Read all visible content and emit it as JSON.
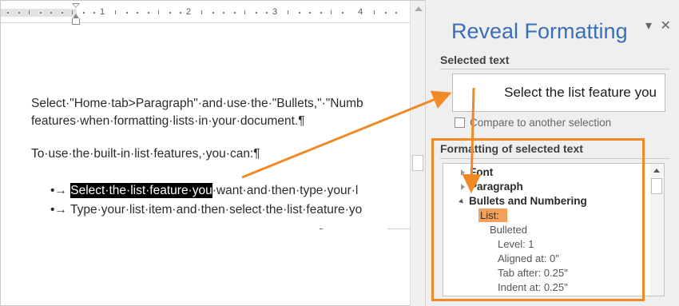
{
  "ruler": {
    "num1": "1",
    "num2": "2",
    "num3": "3",
    "num4": "4"
  },
  "document": {
    "para1_line1": "Select·\"Home·tab>Paragraph\"·and·use·the·\"Bullets,\"·\"Numb",
    "para1_line2": "features·when·formatting·lists·in·your·document.¶",
    "para2": "To·use·the·built-in·list·features,·you·can:¶",
    "bullet1_marker": "•→",
    "bullet1_selected": "Select·the·list·feature·you",
    "bullet1_rest": "·want·and·then·type·your·l",
    "bullet2_marker": "•→",
    "bullet2_text": "Type·your·list·item·and·then·select·the·list·feature·yo"
  },
  "pane": {
    "title": "Reveal Formatting",
    "dropdown_glyph": "▾",
    "close_glyph": "✕",
    "selected_text_label": "Selected text",
    "selected_text_value": "Select the list feature you",
    "compare_label": "Compare to another selection",
    "formatting_label": "Formatting of selected text",
    "tree": {
      "font": "Font",
      "paragraph": "Paragraph",
      "bullets": "Bullets and Numbering",
      "list": "List:",
      "bulleted": "Bulleted",
      "level": "Level: 1",
      "aligned": "Aligned at:  0\"",
      "tab_after": "Tab after:  0.25\"",
      "indent": "Indent at:  0.25\""
    }
  },
  "colors": {
    "accent": "#f08a24",
    "title_blue": "#3b6fb5",
    "highlight_orange": "#f5a05a"
  }
}
